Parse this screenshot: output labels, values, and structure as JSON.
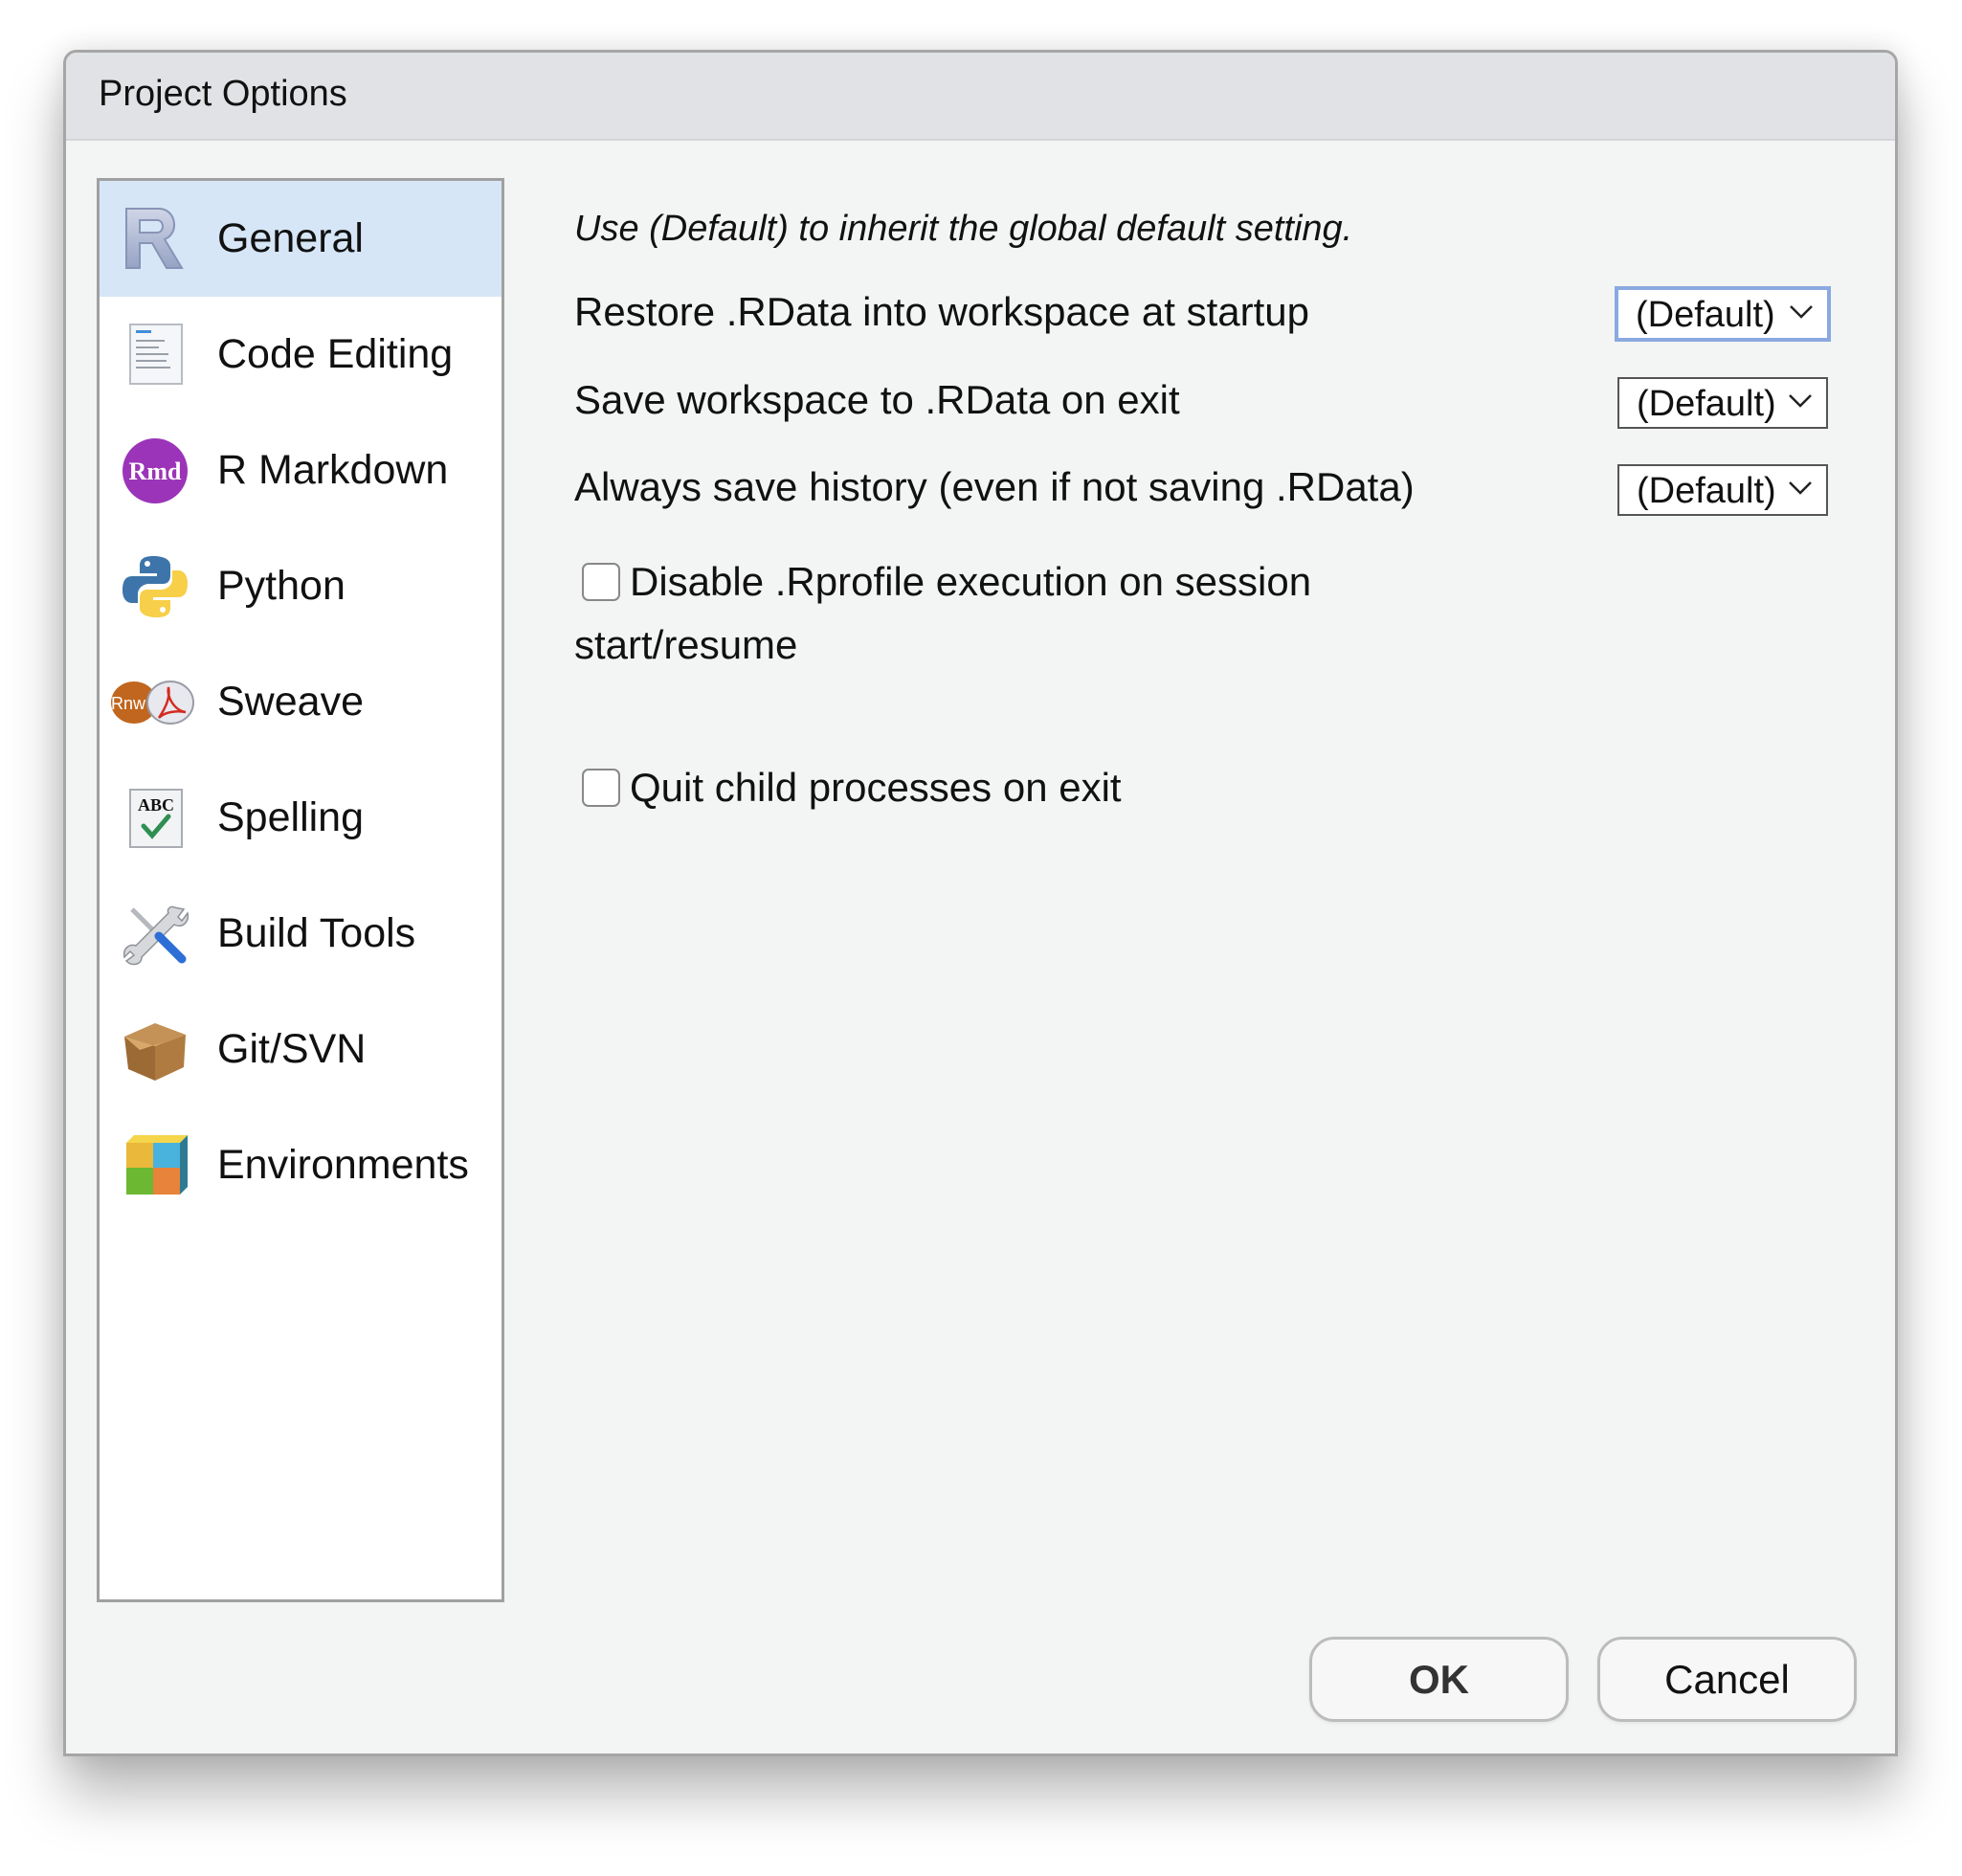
{
  "window": {
    "title": "Project Options"
  },
  "sidebar": {
    "selected": "General",
    "items": [
      {
        "label": "General",
        "icon": "r-logo-icon"
      },
      {
        "label": "Code Editing",
        "icon": "code-document-icon"
      },
      {
        "label": "R Markdown",
        "icon": "rmd-icon"
      },
      {
        "label": "Python",
        "icon": "python-icon"
      },
      {
        "label": "Sweave",
        "icon": "sweave-rnw-pdf-icon"
      },
      {
        "label": "Spelling",
        "icon": "spelling-abc-check-icon"
      },
      {
        "label": "Build Tools",
        "icon": "wrench-screwdriver-icon"
      },
      {
        "label": "Git/SVN",
        "icon": "cardboard-box-icon"
      },
      {
        "label": "Environments",
        "icon": "colored-blocks-icon"
      }
    ]
  },
  "general": {
    "hint": "Use (Default) to inherit the global default setting.",
    "options": [
      {
        "label": "Restore .RData into workspace at startup",
        "value": "(Default)"
      },
      {
        "label": "Save workspace to .RData on exit",
        "value": "(Default)"
      },
      {
        "label": "Always save history (even if not saving .RData)",
        "value": "(Default)"
      }
    ],
    "checkboxes": [
      {
        "label": "Disable .Rprofile execution on session start/resume",
        "checked": false
      },
      {
        "label": "Quit child processes on exit",
        "checked": false
      }
    ]
  },
  "buttons": {
    "ok": "OK",
    "cancel": "Cancel"
  },
  "colors": {
    "selection": "#d6e6f6",
    "focus_border": "#8aa9e0"
  }
}
